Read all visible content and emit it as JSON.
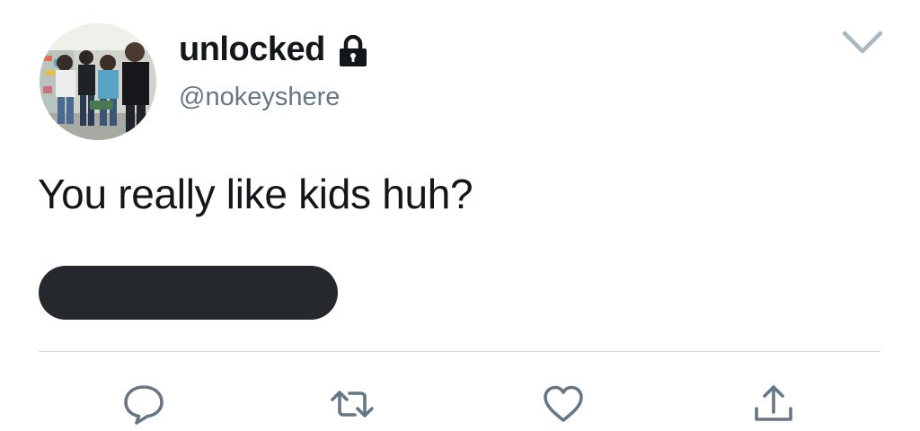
{
  "tweet": {
    "author": {
      "display_name": "unlocked",
      "handle": "@nokeyshere",
      "avatar_icon": "group-photo-avatar",
      "lock_icon": "lock-icon"
    },
    "text": "You really like kids huh?",
    "redacted": true,
    "actions": [
      {
        "name": "reply",
        "icon": "reply-icon"
      },
      {
        "name": "retweet",
        "icon": "retweet-icon"
      },
      {
        "name": "like",
        "icon": "heart-icon"
      },
      {
        "name": "share",
        "icon": "share-icon"
      }
    ]
  },
  "colors": {
    "text": "#14171a",
    "secondary": "#657786",
    "redaction": "#25282c",
    "divider": "#d6d9db",
    "icon": "#657786"
  }
}
